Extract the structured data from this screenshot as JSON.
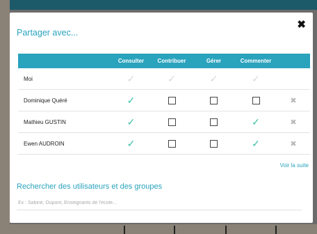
{
  "dialog": {
    "title": "Partager avec...",
    "close_glyph": "✖"
  },
  "table": {
    "columns": [
      "Consulter",
      "Contribuer",
      "Gérer",
      "Commenter"
    ],
    "rows": [
      {
        "name": "Moi",
        "perms": [
          "checked-disabled",
          "checked-disabled",
          "checked-disabled",
          "checked-disabled"
        ],
        "removable": false
      },
      {
        "name": "Dominique Quéré",
        "perms": [
          "checked",
          "unchecked",
          "unchecked",
          "unchecked"
        ],
        "removable": true
      },
      {
        "name": "Mathieu GUSTIN",
        "perms": [
          "checked",
          "unchecked",
          "unchecked",
          "checked"
        ],
        "removable": true
      },
      {
        "name": "Ewen AUDROIN",
        "perms": [
          "checked",
          "unchecked",
          "unchecked",
          "checked"
        ],
        "removable": true
      }
    ]
  },
  "more_link": "Voir la suite",
  "search": {
    "title": "Rechercher des utilisateurs et des groupes",
    "placeholder": "Ex : Sabine, Dupont, Enseignants de l'école..."
  },
  "colors": {
    "accent": "#2aa3bd",
    "check": "#3cc0a6"
  }
}
